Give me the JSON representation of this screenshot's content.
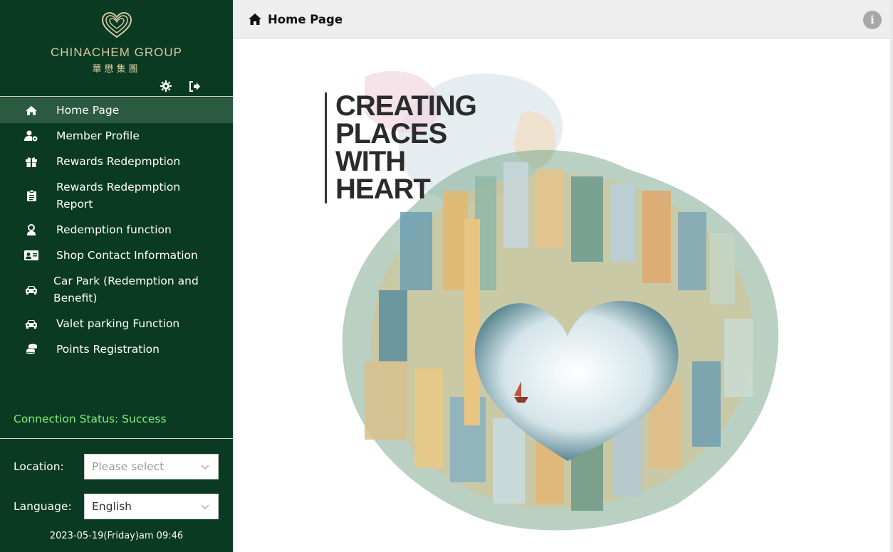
{
  "brand": {
    "name_en": "CHINACHEM GROUP",
    "name_zh": "華懋集團",
    "accent_color": "#d8c9a0"
  },
  "sidebar": {
    "bg_color": "#0a3a22",
    "items": [
      {
        "label": "Home Page",
        "icon": "home-icon",
        "active": true
      },
      {
        "label": "Member Profile",
        "icon": "user-cog-icon"
      },
      {
        "label": "Rewards Redepmption",
        "icon": "gift-icon"
      },
      {
        "label": "Rewards Redepmption Report",
        "icon": "clipboard-icon"
      },
      {
        "label": "Redemption function",
        "icon": "user-badge-icon"
      },
      {
        "label": "Shop Contact Information",
        "icon": "id-card-icon"
      },
      {
        "label": "Car Park (Redemption and Benefit)",
        "icon": "car-icon"
      },
      {
        "label": "Valet parking Function",
        "icon": "car-icon"
      },
      {
        "label": "Points Registration",
        "icon": "coins-icon"
      }
    ],
    "connection_status": "Connection Status: Success",
    "connection_color": "#7dee7d",
    "location_label": "Location:",
    "location_placeholder": "Please select",
    "language_label": "Language:",
    "language_value": "English",
    "datetime": "2023-05-19(Friday)am 09:46"
  },
  "header": {
    "title": "Home Page",
    "info_icon": "info-icon"
  },
  "banner": {
    "lines": [
      "CREATING",
      "PLACES",
      "WITH",
      "HEART"
    ]
  }
}
